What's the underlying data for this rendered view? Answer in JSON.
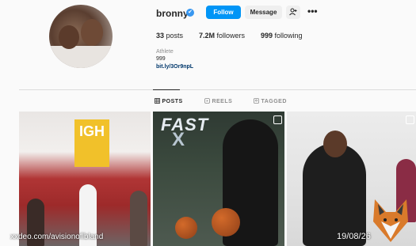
{
  "profile": {
    "username": "bronny",
    "verified_glyph": "✔",
    "follow_label": "Follow",
    "message_label": "Message",
    "suggest_icon": "add-person-icon",
    "more_glyph": "•••"
  },
  "stats": {
    "posts_count": "33",
    "posts_label": "posts",
    "followers_count": "7.2M",
    "followers_label": "followers",
    "following_count": "999",
    "following_label": "following"
  },
  "bio": {
    "category": "Athlete",
    "text": "999",
    "link": "bit.ly/3Or9npL"
  },
  "tabs": [
    {
      "label": "POSTS",
      "active": true
    },
    {
      "label": "REELS",
      "active": false
    },
    {
      "label": "TAGGED",
      "active": false
    }
  ],
  "posts": [
    {
      "sign_text": "IGH"
    },
    {
      "logo_top": "FAST",
      "logo_bottom": "X"
    },
    {}
  ],
  "overlay": {
    "watermark": "xxdeo.com/avisionoflbland",
    "date": "19/08/26"
  },
  "colors": {
    "accent": "#0095f6",
    "verified": "#3897f0"
  }
}
